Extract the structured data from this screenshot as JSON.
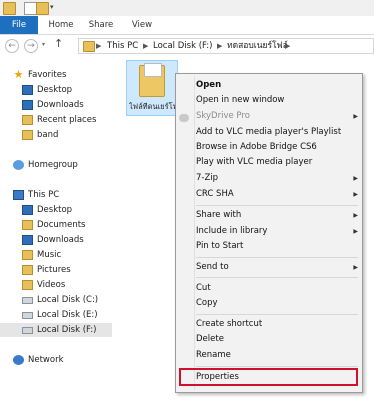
{
  "ribbon": {
    "tabs": [
      "File",
      "Home",
      "Share",
      "View"
    ]
  },
  "address": {
    "back": "←",
    "forward": "→",
    "up": "↑",
    "crumbs": [
      "This PC",
      "Local Disk (F:)",
      "ทดสอบเนยร์โฟล์"
    ]
  },
  "nav": {
    "favorites": "Favorites",
    "fav_items": [
      "Desktop",
      "Downloads",
      "Recent places",
      "band"
    ],
    "homegroup": "Homegroup",
    "thispc": "This PC",
    "pc_items": [
      "Desktop",
      "Documents",
      "Downloads",
      "Music",
      "Pictures",
      "Videos",
      "Local Disk (C:)",
      "Local Disk (E:)",
      "Local Disk (F:)"
    ],
    "network": "Network"
  },
  "content": {
    "folder_name": "ไฟล์ทีดนเยร์โฟล์"
  },
  "context_menu": {
    "open": "Open",
    "open_new_window": "Open in new window",
    "skydrive": "SkyDrive Pro",
    "vlc_playlist": "Add to VLC media player's Playlist",
    "bridge": "Browse in Adobe Bridge CS6",
    "vlc_play": "Play with VLC media player",
    "zip": "7-Zip",
    "crc": "CRC SHA",
    "share_with": "Share with",
    "include_library": "Include in library",
    "pin_start": "Pin to Start",
    "send_to": "Send to",
    "cut": "Cut",
    "copy": "Copy",
    "create_shortcut": "Create shortcut",
    "delete": "Delete",
    "rename": "Rename",
    "properties": "Properties"
  },
  "colors": {
    "accent": "#1e6fbf",
    "highlight": "#d0112b",
    "selection": "#cde8ff"
  }
}
